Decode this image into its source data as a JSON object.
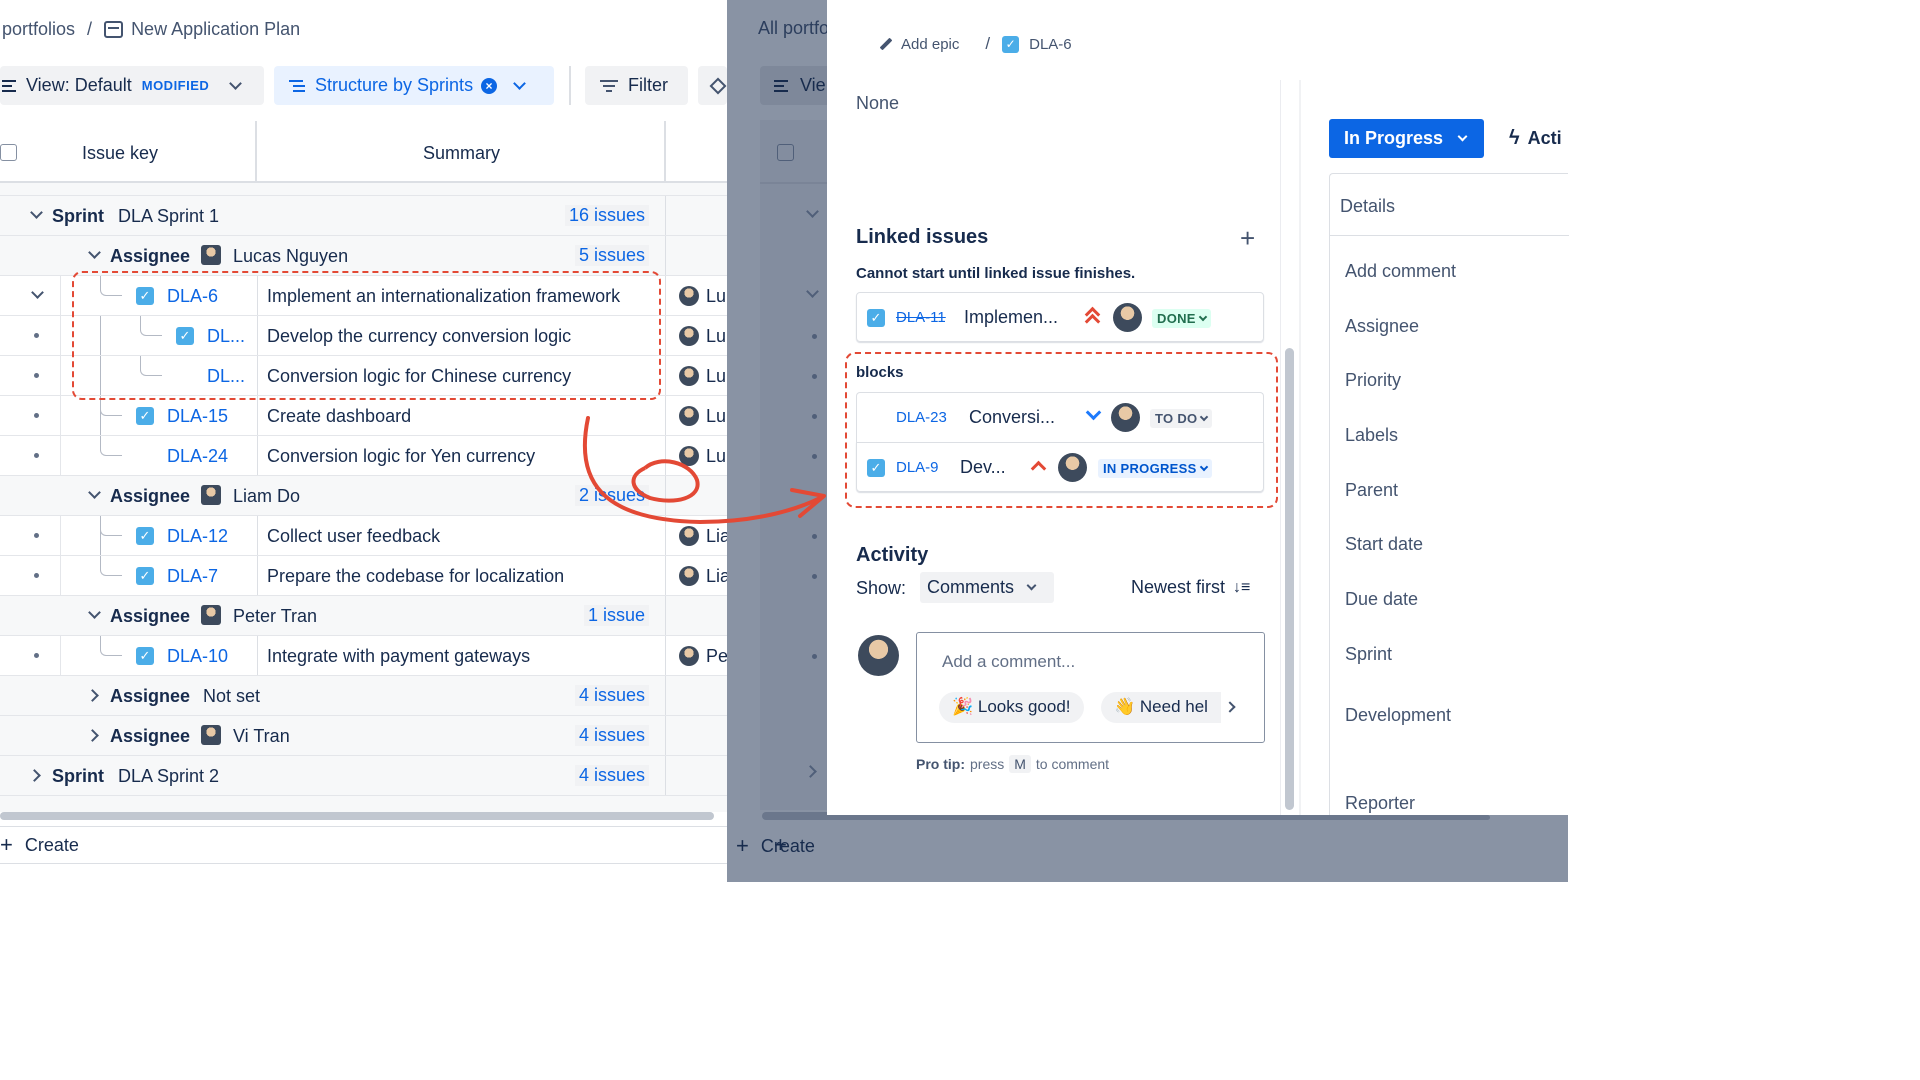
{
  "breadcrumb": {
    "parent": "portfolios",
    "separator": "/",
    "current": "New Application Plan"
  },
  "toolbar": {
    "view_label": "View: Default",
    "view_badge": "MODIFIED",
    "structure_label": "Structure by Sprints",
    "filter_label": "Filter"
  },
  "table": {
    "col_issue_key": "Issue key",
    "col_summary": "Summary"
  },
  "rows": {
    "sprint1": {
      "label": "Sprint",
      "value": "DLA Sprint 1",
      "count": "16 issues"
    },
    "assignee_lucas": {
      "label": "Assignee",
      "value": "Lucas Nguyen",
      "count": "5 issues"
    },
    "dla6": {
      "key": "DLA-6",
      "summary": "Implement an internationalization framework",
      "assignee": "Lu"
    },
    "dl_a": {
      "key": "DL...",
      "summary": "Develop the currency conversion logic",
      "assignee": "Lu"
    },
    "dl_b": {
      "key": "DL...",
      "summary": "Conversion logic for Chinese currency",
      "assignee": "Lu"
    },
    "dla15": {
      "key": "DLA-15",
      "summary": "Create dashboard",
      "assignee": "Lu"
    },
    "dla24": {
      "key": "DLA-24",
      "summary": "Conversion logic for Yen currency",
      "assignee": "Lu"
    },
    "assignee_liam": {
      "label": "Assignee",
      "value": "Liam Do",
      "count": "2 issues"
    },
    "dla12": {
      "key": "DLA-12",
      "summary": "Collect user feedback",
      "assignee": "Lia"
    },
    "dla7": {
      "key": "DLA-7",
      "summary": "Prepare the codebase for localization",
      "assignee": "Lia"
    },
    "assignee_peter": {
      "label": "Assignee",
      "value": "Peter Tran",
      "count": "1 issue"
    },
    "dla10": {
      "key": "DLA-10",
      "summary": "Integrate with payment gateways",
      "assignee": "Pe"
    },
    "assignee_notset": {
      "label": "Assignee",
      "value": "Not set",
      "count": "4 issues"
    },
    "assignee_vi": {
      "label": "Assignee",
      "value": "Vi Tran",
      "count": "4 issues"
    },
    "sprint2": {
      "label": "Sprint",
      "value": "DLA Sprint 2",
      "count": "4 issues"
    }
  },
  "create_label": "Create",
  "background": {
    "breadcrumb": "All portfo",
    "view": "Vie",
    "create": "Create"
  },
  "panel": {
    "add_epic": "Add epic",
    "issue_key": "DLA-6",
    "none_text": "None",
    "linked_title": "Linked issues",
    "linked_subtitle": "Cannot start until linked issue finishes.",
    "linked": [
      {
        "key": "DLA-11",
        "summary": "Implemen...",
        "status": "DONE"
      }
    ],
    "blocks_title": "blocks",
    "blocks": [
      {
        "key": "DLA-23",
        "summary": "Conversi...",
        "status": "TO DO"
      },
      {
        "key": "DLA-9",
        "summary": "Dev...",
        "status": "IN PROGRESS"
      }
    ],
    "activity_title": "Activity",
    "show_label": "Show:",
    "show_value": "Comments",
    "sort_label": "Newest first",
    "comment_placeholder": "Add a comment...",
    "quick1": "🎉 Looks good!",
    "quick2": "👋 Need hel",
    "protip_bold": "Pro tip:",
    "protip_press": "press",
    "protip_key": "M",
    "protip_rest": "to comment",
    "status_button": "In Progress",
    "actions_partial": "Acti",
    "details_title": "Details",
    "fields": [
      "Add comment",
      "Assignee",
      "Priority",
      "Labels",
      "Parent",
      "Start date",
      "Due date",
      "Sprint",
      "Development",
      "Reporter"
    ]
  },
  "colors": {
    "accent": "#0c66e4",
    "highlight": "#e34935",
    "done": "#216e4e",
    "done_bg": "#dcfff1",
    "todo_bg": "#f1f2f4",
    "inprog_bg": "#e9f2ff"
  }
}
